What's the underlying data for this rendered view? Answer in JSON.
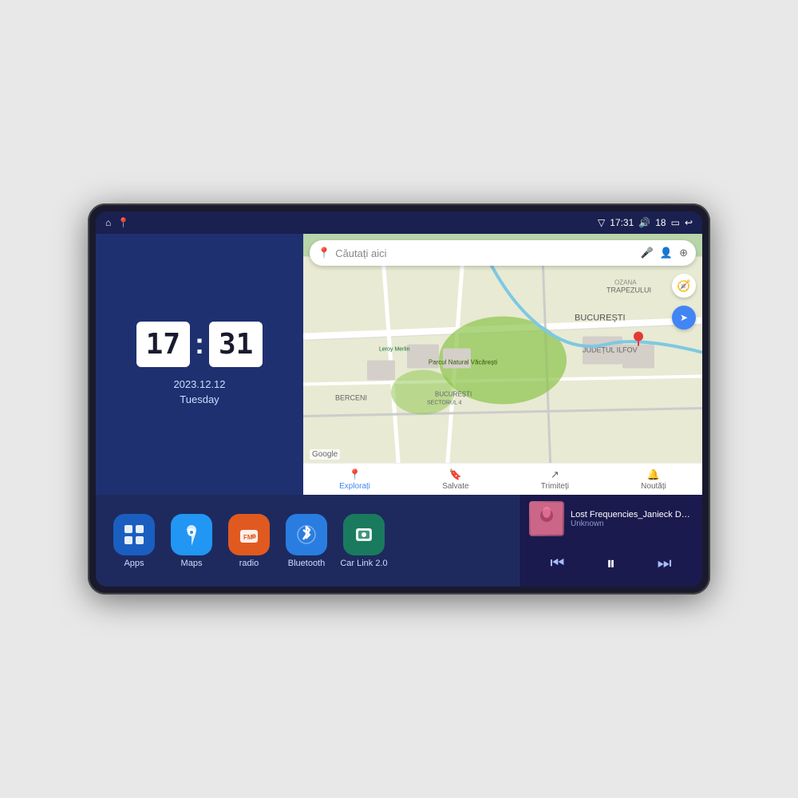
{
  "device": {
    "status_bar": {
      "signal_icon": "▽",
      "time": "17:31",
      "volume_icon": "🔊",
      "battery_level": "18",
      "battery_icon": "▭",
      "back_icon": "↩"
    },
    "clock": {
      "hours": "17",
      "minutes": "31",
      "date": "2023.12.12",
      "day": "Tuesday"
    },
    "map": {
      "search_placeholder": "Căutați aici",
      "google_label": "Google",
      "tabs": [
        {
          "label": "Explorați",
          "icon": "📍",
          "active": true
        },
        {
          "label": "Salvate",
          "icon": "🔖",
          "active": false
        },
        {
          "label": "Trimiteți",
          "icon": "🔄",
          "active": false
        },
        {
          "label": "Noutăți",
          "icon": "🔔",
          "active": false
        }
      ]
    },
    "apps": [
      {
        "name": "Apps",
        "icon": "⊞",
        "color_class": "apps-color"
      },
      {
        "name": "Maps",
        "icon": "📍",
        "color_class": "maps-color"
      },
      {
        "name": "radio",
        "icon": "📻",
        "color_class": "radio-color"
      },
      {
        "name": "Bluetooth",
        "icon": "⚡",
        "color_class": "bluetooth-color"
      },
      {
        "name": "Car Link 2.0",
        "icon": "📱",
        "color_class": "carlink-color"
      }
    ],
    "media": {
      "title": "Lost Frequencies_Janieck Devy-...",
      "artist": "Unknown",
      "thumbnail_emoji": "🎵",
      "prev_icon": "⏮",
      "play_icon": "⏸",
      "next_icon": "⏭"
    }
  }
}
